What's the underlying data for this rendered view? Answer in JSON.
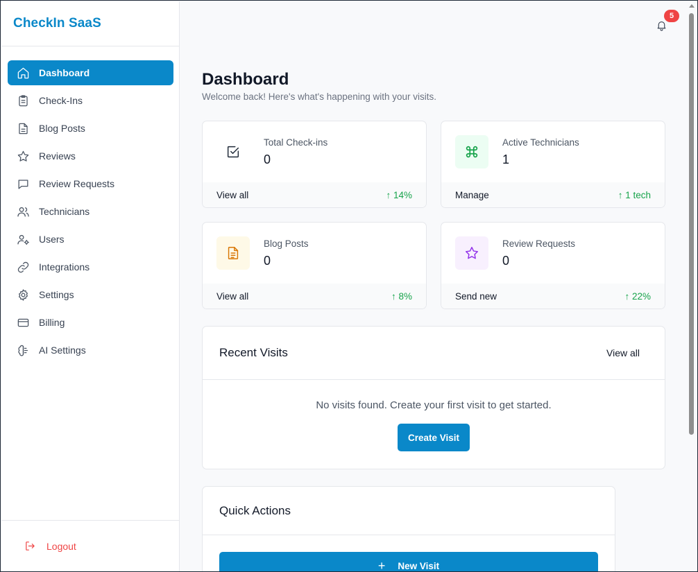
{
  "brand": {
    "name": "CheckIn SaaS"
  },
  "sidebar": {
    "items": [
      {
        "label": "Dashboard",
        "icon": "home-icon"
      },
      {
        "label": "Check-Ins",
        "icon": "clipboard-icon"
      },
      {
        "label": "Blog Posts",
        "icon": "document-icon"
      },
      {
        "label": "Reviews",
        "icon": "star-icon"
      },
      {
        "label": "Review Requests",
        "icon": "message-icon"
      },
      {
        "label": "Technicians",
        "icon": "users-icon"
      },
      {
        "label": "Users",
        "icon": "user-cog-icon"
      },
      {
        "label": "Integrations",
        "icon": "link-icon"
      },
      {
        "label": "Settings",
        "icon": "gear-icon"
      },
      {
        "label": "Billing",
        "icon": "credit-card-icon"
      },
      {
        "label": "AI Settings",
        "icon": "brain-icon"
      }
    ],
    "logout_label": "Logout"
  },
  "header": {
    "notification_count": "5"
  },
  "main": {
    "title": "Dashboard",
    "subtitle": "Welcome back! Here's what's happening with your visits.",
    "cards": [
      {
        "label": "Total Check-ins",
        "value": "0",
        "link": "View all",
        "trend": "↑ 14%",
        "icon": "check-square-icon",
        "icon_bg": "#ffffff",
        "icon_color": "#1f2937"
      },
      {
        "label": "Active Technicians",
        "value": "1",
        "link": "Manage",
        "trend": "↑ 1 tech",
        "icon": "command-icon",
        "icon_bg": "#ecfdf3",
        "icon_color": "#16a34a"
      },
      {
        "label": "Blog Posts",
        "value": "0",
        "link": "View all",
        "trend": "↑ 8%",
        "icon": "document-icon",
        "icon_bg": "#fef9e7",
        "icon_color": "#d97706"
      },
      {
        "label": "Review Requests",
        "value": "0",
        "link": "Send new",
        "trend": "↑ 22%",
        "icon": "star-icon",
        "icon_bg": "#f8f0fe",
        "icon_color": "#9333ea"
      }
    ],
    "recent_visits": {
      "title": "Recent Visits",
      "view_all": "View all",
      "empty_text": "No visits found. Create your first visit to get started.",
      "create_button": "Create Visit"
    },
    "quick_actions": {
      "title": "Quick Actions",
      "new_visit_button": "New Visit"
    }
  },
  "colors": {
    "accent": "#0a88c9",
    "danger": "#ef4444",
    "success": "#16a34a"
  }
}
